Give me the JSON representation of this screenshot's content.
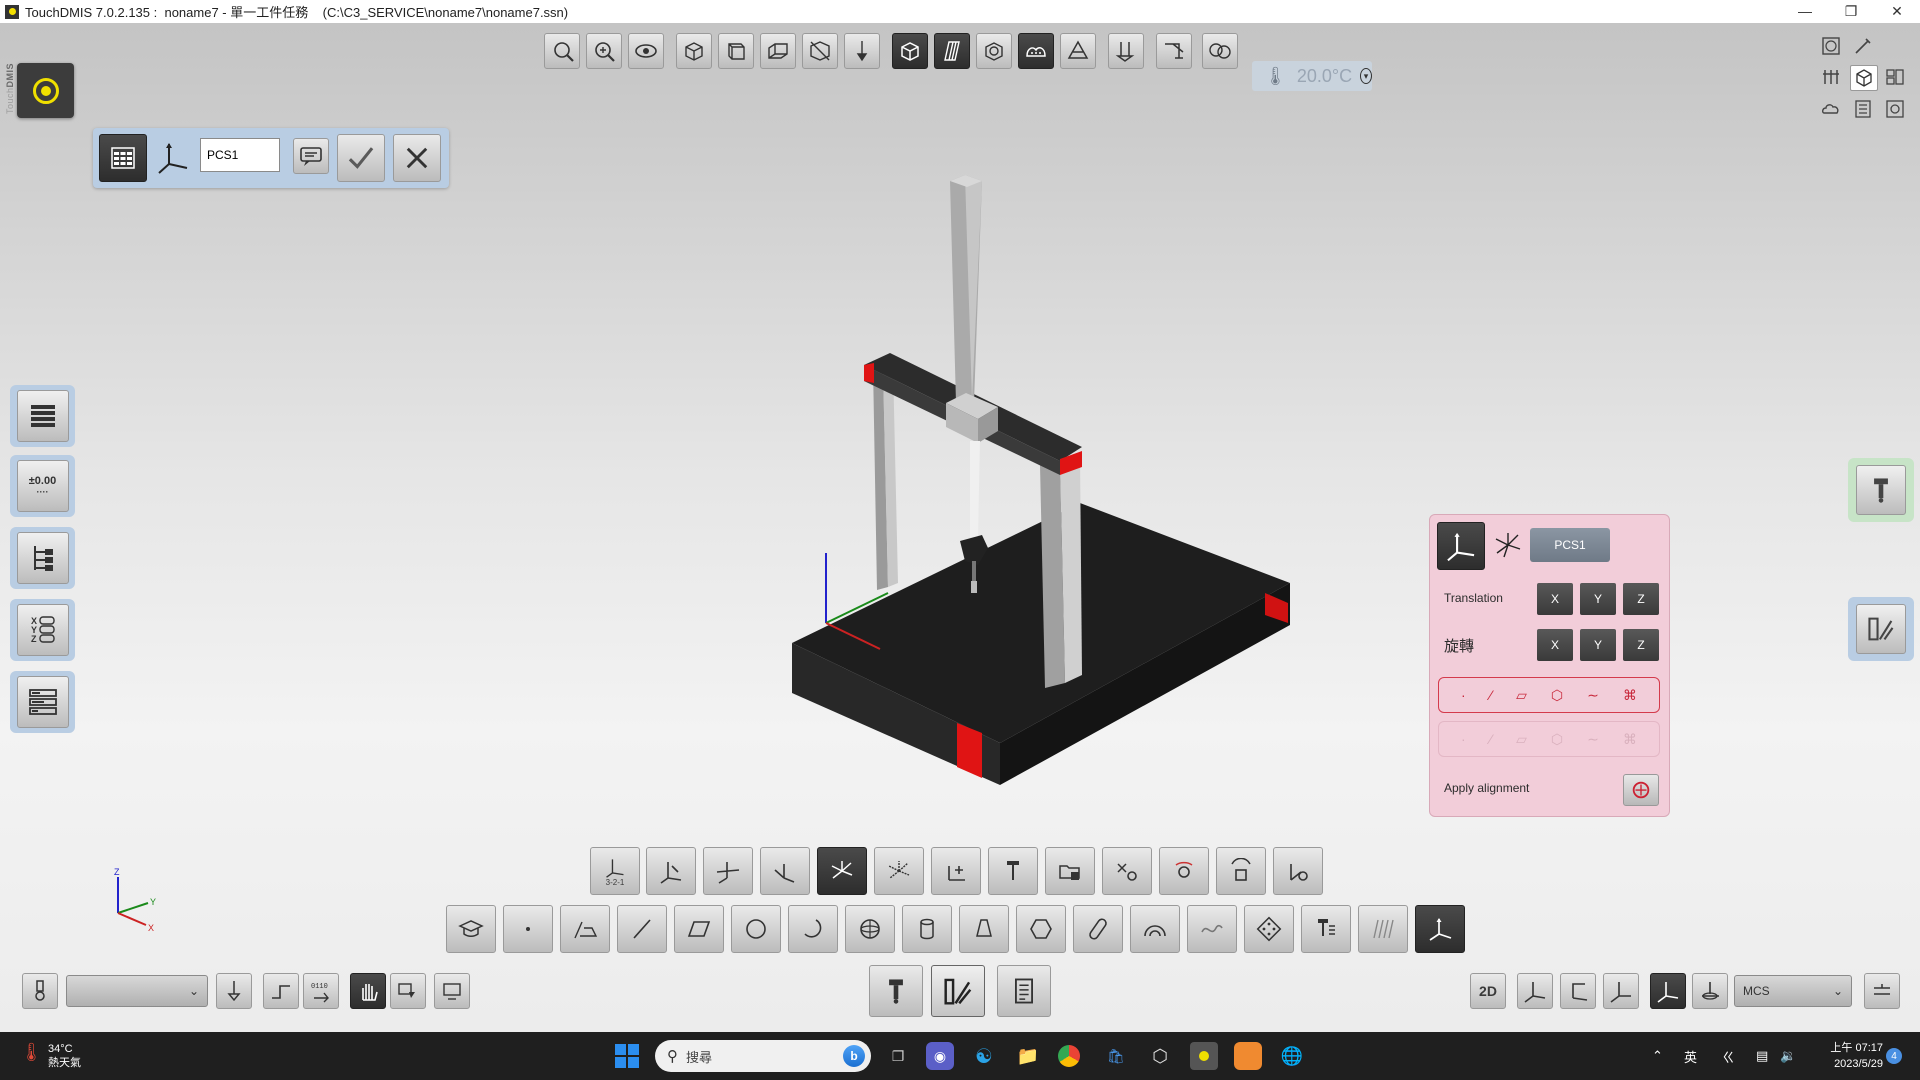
{
  "window": {
    "title": "TouchDMIS 7.0.2.135 :  noname7 - 單一工件任務    (C:\\C3_SERVICE\\noname7\\noname7.ssn)",
    "controls": [
      "minimize-icon",
      "restore-icon",
      "close-icon"
    ]
  },
  "brand": {
    "touch": "Touch",
    "dmis": "DMIS"
  },
  "top_toolbar": {
    "icons": [
      "zoom-fit-icon",
      "zoom-window-icon",
      "view-rotate-icon",
      "view-iso-icon",
      "view-front-icon",
      "view-side-icon",
      "view-section-icon",
      "probe-view-icon",
      "solid-view-icon",
      "wireframe-view-icon",
      "transparent-view-icon",
      "pointcloud-view-icon",
      "machine-model-icon",
      "probe-change-icon",
      "fixture-icon",
      "multi-view-icon"
    ],
    "temperature": "20.0°C"
  },
  "alignment_toolbar": {
    "pcs_value": "PCS1",
    "icons": [
      "table-icon",
      "coordinate-system-icon",
      "comment-icon",
      "confirm-icon",
      "cancel-icon"
    ]
  },
  "left_panel": {
    "buttons": [
      "program-list-icon",
      "tolerance-icon",
      "tree-icon",
      "xyz-list-icon",
      "report-icon"
    ],
    "tolerance_label": "±0.00"
  },
  "align_panel": {
    "pcs_label": "PCS1",
    "translation_label": "Translation",
    "rotation_label": "旋轉",
    "axes": [
      "X",
      "Y",
      "Z"
    ],
    "apply_label": "Apply alignment",
    "feature_row": [
      "·",
      "⁄",
      "▱",
      "⬡",
      "∼",
      "⌘"
    ]
  },
  "axis_triad": {
    "x": "X",
    "y": "Y",
    "z": "Z"
  },
  "bottom_toolbar_1": {
    "labels": [
      "3-2-1"
    ]
  },
  "bottom_status": {
    "mode_2d": "2D",
    "coord_select": "MCS"
  },
  "taskbar": {
    "temperature": "34°C",
    "weather": "熱天氣",
    "search_placeholder": "搜尋",
    "lang": "英",
    "time": "上午 07:17",
    "date": "2023/5/29",
    "notification_count": "4"
  }
}
